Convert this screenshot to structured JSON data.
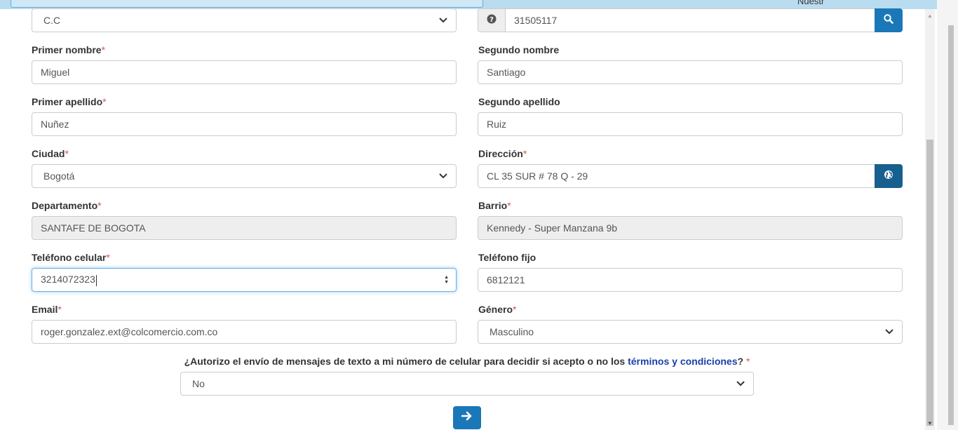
{
  "topbar": {
    "tab_label": "Nuestr"
  },
  "form": {
    "doc_type": {
      "value": "C.C"
    },
    "doc_number": {
      "value": "31505117"
    },
    "primer_nombre": {
      "label": "Primer nombre",
      "value": "Miguel"
    },
    "segundo_nombre": {
      "label": "Segundo nombre",
      "value": "Santiago"
    },
    "primer_apellido": {
      "label": "Primer apellido",
      "value": "Nuñez"
    },
    "segundo_apellido": {
      "label": "Segundo apellido",
      "value": "Ruiz"
    },
    "ciudad": {
      "label": "Ciudad",
      "value": "Bogotá"
    },
    "direccion": {
      "label": "Dirección",
      "value": "CL 35 SUR # 78 Q - 29"
    },
    "departamento": {
      "label": "Departamento",
      "value": "SANTAFE DE BOGOTA"
    },
    "barrio": {
      "label": "Barrio",
      "value": "Kennedy - Super Manzana 9b"
    },
    "telefono_celular": {
      "label": "Teléfono celular",
      "value": "3214072323"
    },
    "telefono_fijo": {
      "label": "Teléfono fijo",
      "value": "6812121"
    },
    "email": {
      "label": "Email",
      "value": "roger.gonzalez.ext@colcomercio.com.co"
    },
    "genero": {
      "label": "Género",
      "value": "Masculino"
    },
    "required_mark": "*"
  },
  "consent": {
    "question_prefix": "¿Autorizo el envío de mensajes de texto a mi número de celular para decidir si acepto o no los ",
    "link_terminos": "términos",
    "link_y": " y ",
    "link_condiciones": "condiciones",
    "question_suffix": "?",
    "required_mark": " *",
    "value": "No"
  },
  "icons": {
    "question": "question-circle-icon",
    "search": "search-icon",
    "globe": "globe-icon",
    "arrow": "arrow-right-icon",
    "chevron": "chevron-down-icon"
  },
  "colors": {
    "primary": "#1a78b8",
    "primary_dark": "#175f8f",
    "required": "#d9534f",
    "link": "#1a3fa8"
  }
}
